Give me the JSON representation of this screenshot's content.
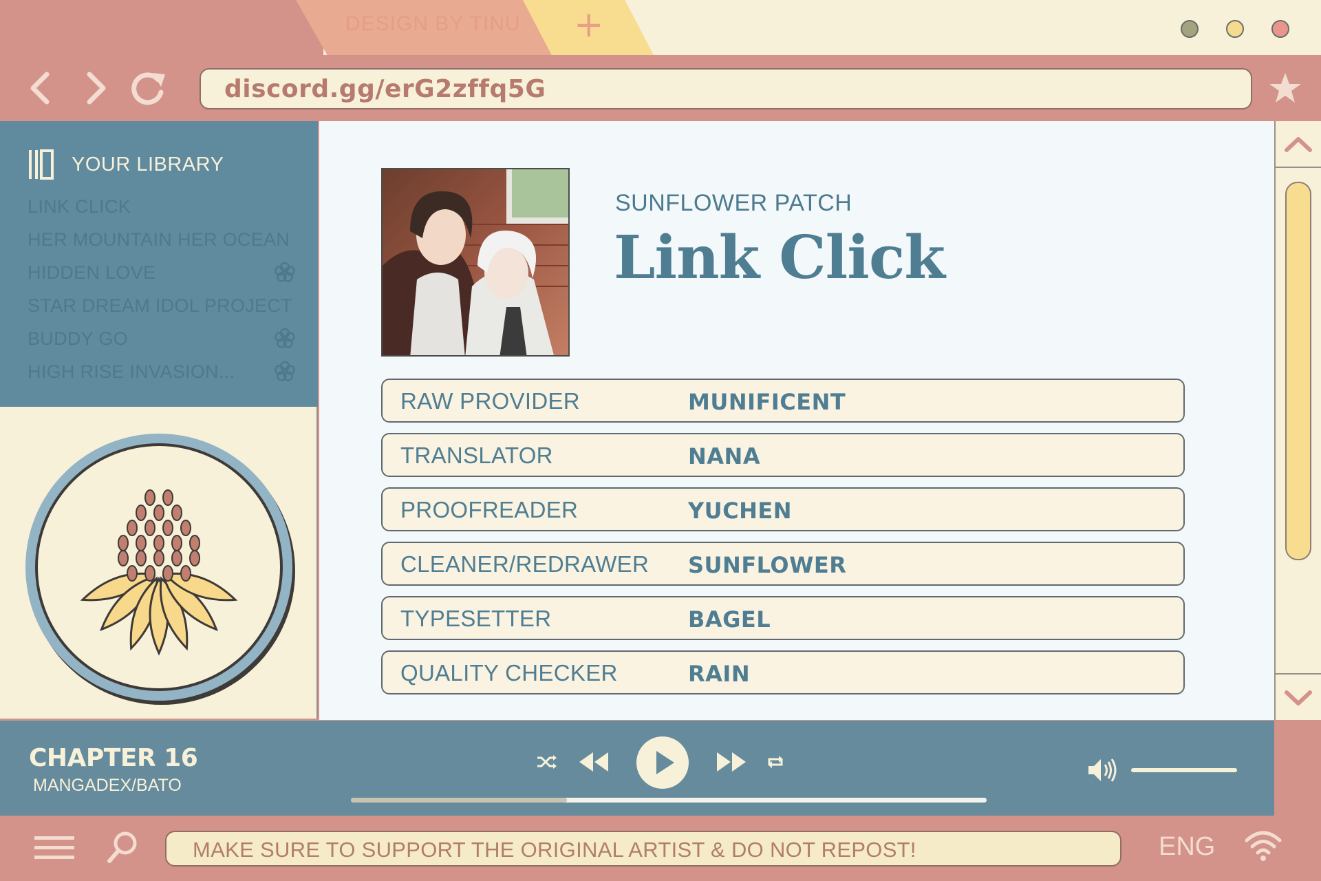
{
  "browser": {
    "tab_title": "DESIGN BY TINU",
    "new_tab_symbol": "+",
    "url": "discord.gg/erG2zffq5G"
  },
  "sidebar": {
    "library_title": "YOUR LIBRARY",
    "items": [
      {
        "label": "LINK CLICK",
        "flower_icon": false
      },
      {
        "label": "HER MOUNTAIN HER OCEAN",
        "flower_icon": false
      },
      {
        "label": "HIDDEN LOVE",
        "flower_icon": true
      },
      {
        "label": "STAR DREAM IDOL PROJECT",
        "flower_icon": false
      },
      {
        "label": "BUDDY GO",
        "flower_icon": true
      },
      {
        "label": "HIGH RISE INVASION...",
        "flower_icon": true
      }
    ]
  },
  "main": {
    "group_name": "SUNFLOWER PATCH",
    "series_title": "Link Click",
    "credits": [
      {
        "role": "RAW PROVIDER",
        "name": "MUNIFICENT"
      },
      {
        "role": "TRANSLATOR",
        "name": "NANA"
      },
      {
        "role": "PROOFREADER",
        "name": "YUCHEN"
      },
      {
        "role": "CLEANER/REDRAWER",
        "name": "SUNFLOWER"
      },
      {
        "role": "TYPESETTER",
        "name": "BAGEL"
      },
      {
        "role": "QUALITY CHECKER",
        "name": "RAIN"
      }
    ]
  },
  "player": {
    "chapter": "CHAPTER 16",
    "source": "MANGADEX/BATO",
    "progress_fraction": 0.34,
    "volume_fraction": 1.0
  },
  "bottombar": {
    "notice": "MAKE SURE TO SUPPORT THE ORIGINAL ARTIST & DO NOT REPOST!",
    "language": "ENG"
  },
  "colors": {
    "frame_pink": "#d3928a",
    "cream": "#f8f1da",
    "teal": "#658b9c",
    "dark_teal_text": "#4f7d92",
    "yellow": "#f8dd90",
    "window_dot_green": "#a1a47f",
    "window_dot_yellow": "#f5db8e",
    "window_dot_pink": "#e8958c"
  },
  "icons": [
    "back-arrow-icon",
    "forward-arrow-icon",
    "reload-icon",
    "star-icon",
    "library-icon",
    "flower-icon",
    "shuffle-icon",
    "rewind-icon",
    "play-icon",
    "fast-forward-icon",
    "repeat-icon",
    "volume-icon",
    "menu-icon",
    "search-icon",
    "wifi-icon",
    "chevron-up-icon",
    "chevron-down-icon"
  ]
}
